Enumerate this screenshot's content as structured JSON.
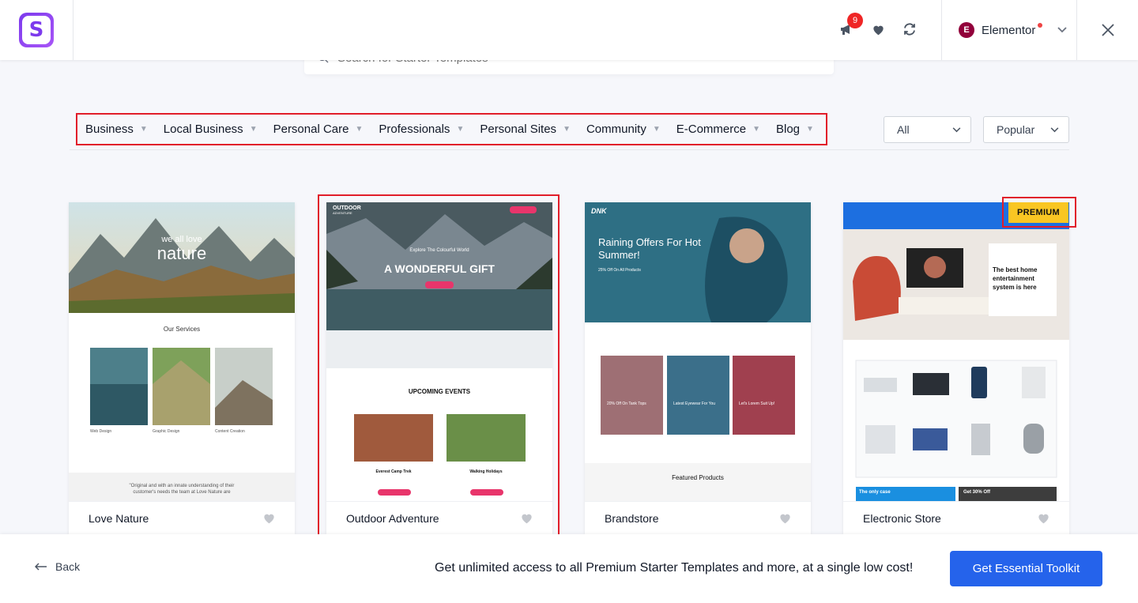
{
  "header": {
    "logo_letter": "S",
    "notification_count": "9",
    "builder_logo_letter": "E",
    "builder_label": "Elementor"
  },
  "search": {
    "placeholder": "Search for Starter Templates"
  },
  "categories": [
    "Business",
    "Local Business",
    "Personal Care",
    "Professionals",
    "Personal Sites",
    "Community",
    "E-Commerce",
    "Blog"
  ],
  "filters": {
    "type": "All",
    "sort": "Popular"
  },
  "templates": [
    {
      "title": "Love Nature",
      "premium": false,
      "thumb": {
        "hero_line1": "we all love",
        "hero_line2": "nature",
        "section": "Our Services",
        "items": [
          "Web Design",
          "Graphic Design",
          "Content Creation"
        ],
        "quote": "\"Original and with an innate understanding of their customer's needs the team at Love Nature are"
      }
    },
    {
      "title": "Outdoor Adventure",
      "premium": false,
      "thumb": {
        "brand": "OUTDOOR",
        "brand_sub": "ADVENTURE",
        "kicker": "Explore The Colourful World",
        "headline": "A WONDERFUL GIFT",
        "section": "UPCOMING EVENTS",
        "events": [
          "Everest Camp Trek",
          "Walking Holidays"
        ]
      }
    },
    {
      "title": "Brandstore",
      "premium": false,
      "thumb": {
        "brand": "DNK",
        "headline": "Raining Offers For Hot Summer!",
        "sub": "25% Off On All Products",
        "tiles": [
          "20% Off On Tank Tops",
          "Latest Eyewear For You",
          "Let's Lorem Suit Up!"
        ],
        "section": "Featured Products"
      }
    },
    {
      "title": "Electronic Store",
      "premium": true,
      "premium_label": "PREMIUM",
      "thumb": {
        "headline": "The best home entertainment system is here",
        "promo": "The only case",
        "promo2": "Get 30% Off"
      }
    }
  ],
  "footer": {
    "back_label": "Back",
    "promo_text": "Get unlimited access to all Premium Starter Templates and more, at a single low cost!",
    "cta_label": "Get Essential Toolkit"
  },
  "colors": {
    "accent": "#2563eb",
    "highlight": "#e11d2a",
    "premium": "#f9c623",
    "brand": "#7c3aed"
  }
}
